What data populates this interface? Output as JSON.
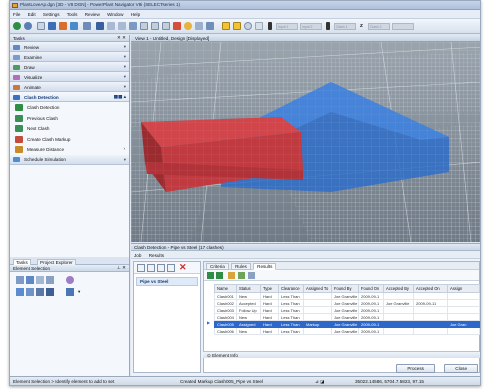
{
  "window": {
    "title": "PlantLoveAp.dgn [3D - V8 DGN] - PowerPlant Navigator V8i (SELECTseries 1)"
  },
  "menu": [
    "File",
    "Edit",
    "Settings",
    "Tools",
    "Review",
    "Window",
    "Help"
  ],
  "toolbar": {
    "disabled_fields": [
      "Input 1",
      "Input 2",
      "Clash 1",
      "Clash 2"
    ],
    "zoom_label": "Z"
  },
  "tasks": {
    "title": "Tasks",
    "close": "✕ ✕",
    "sections": [
      {
        "label": "Review",
        "color": "#5f88c6"
      },
      {
        "label": "Examine",
        "color": "#7a9ccc"
      },
      {
        "label": "Draw",
        "color": "#4f9b5f"
      },
      {
        "label": "Visualize",
        "color": "#b26fb8"
      },
      {
        "label": "Animate",
        "color": "#c87a3a"
      }
    ],
    "open_section": {
      "label": "Clash Detection",
      "color": "#3b6fc6",
      "items": [
        {
          "label": "Clash Detection",
          "color": "#2f8d45"
        },
        {
          "label": "Previous Clash",
          "color": "#3a8f58"
        },
        {
          "label": "Next Clash",
          "color": "#3a8f58"
        },
        {
          "label": "Create Clash Markup",
          "color": "#c54b3b"
        },
        {
          "label": "Measure Distance",
          "color": "#c98a2a"
        }
      ]
    },
    "last_section": {
      "label": "Schedule Simulation",
      "color": "#4c8ed0"
    }
  },
  "lower_panel": {
    "tabs": [
      "Tasks",
      "Project Explorer"
    ],
    "title": "Element Selection"
  },
  "view": {
    "title": "View 1 - Untitled, Design [Displayed]"
  },
  "clash": {
    "title": "Clash Detection - Pipe vs Steel (17 clashes)",
    "tabs": [
      "Job",
      "Results"
    ],
    "test": "Pipe vs Steel",
    "result_tabs": [
      "Criteria",
      "Rules",
      "Results"
    ],
    "columns": [
      "Name",
      "Status",
      "Type",
      "Clearance",
      "Assigned To",
      "Found By",
      "Found On",
      "Accepted By",
      "Accepted On",
      "Assign"
    ],
    "rows": [
      [
        "Clash001",
        "New",
        "Hard",
        "Less Than",
        "",
        "Joe Granville",
        "2009-09-1",
        "",
        "",
        ""
      ],
      [
        "Clash002",
        "Accepted",
        "Hard",
        "Less Than",
        "",
        "Joe Granville",
        "2009-09-1",
        "Joe Granville",
        "2009-09-11",
        ""
      ],
      [
        "Clash003",
        "Follow Up",
        "Hard",
        "Less Than",
        "",
        "Joe Granville",
        "2009-09-1",
        "",
        "",
        ""
      ],
      [
        "Clash004",
        "New",
        "Hard",
        "Less Than",
        "",
        "Joe Granville",
        "2009-09-1",
        "",
        "",
        ""
      ],
      [
        "Clash005",
        "Assigned",
        "Hard",
        "Less Than",
        "Markup",
        "Joe Granville",
        "2009-09-1",
        "",
        "",
        "Joe Gran"
      ],
      [
        "Clash006",
        "New",
        "Hard",
        "Less Than",
        "",
        "Joe Granville",
        "2009-09-1",
        "",
        "",
        ""
      ]
    ],
    "selected_row": 4,
    "element_info": "Element Info",
    "process": "Process",
    "close": "Close"
  },
  "status": {
    "left": "Element Selection > Identify element to add to set",
    "middle": "Created Markup Clash005_Pipe vs Steel",
    "right": "35022.14586, 5704.7.5823, 97.15"
  }
}
